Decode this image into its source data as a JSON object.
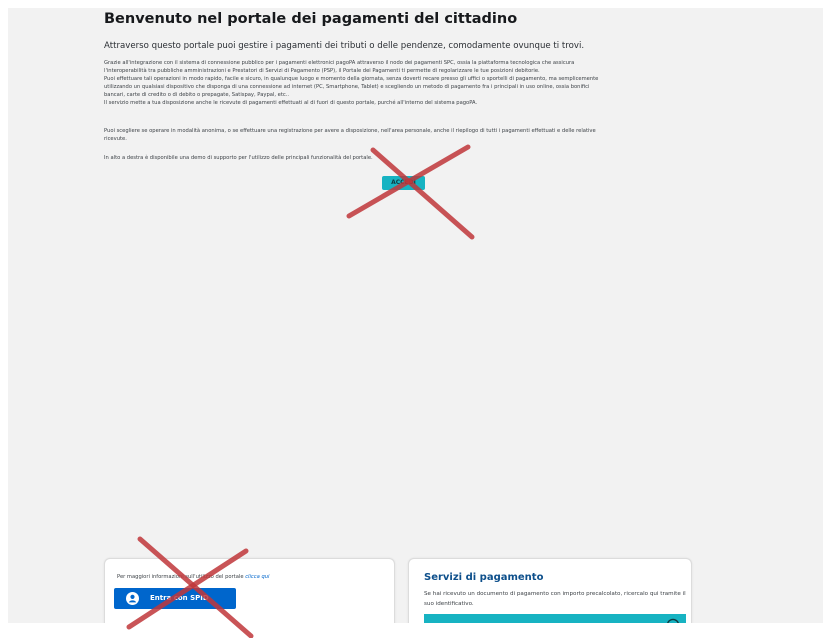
{
  "header": {
    "title": "Benvenuto nel portale dei pagamenti del cittadino",
    "subtitle": "Attraverso questo portale puoi gestire i pagamenti dei tributi o delle pendenze, comodamente ovunque ti trovi."
  },
  "intro": {
    "lines": [
      "Grazie all'integrazione con il sistema di connessione pubblico per i pagamenti elettronici pagoPA attraverso il nodo dei pagamenti SPC, ossia la piattaforma tecnologica che assicura",
      "l'interoperabilità tra pubbliche amministrazioni e Prestatori di Servizi di Pagamento (PSP), il Portale dei Pagamenti ti permette di regolarizzare le tue posizioni debitorie.",
      "Puoi effettuare tali operazioni in modo rapido, facile e sicuro, in qualunque luogo e momento della giornata, senza doverti recare presso gli uffici o sportelli di pagamento, ma semplicemente",
      "utilizzando un qualsiasi dispositivo che disponga di una connessione ad internet (PC, Smartphone, Tablet) e scegliendo un metodo di pagamento fra i principali in uso online, ossia bonifici",
      "bancari, carte di credito o di debito o prepagate, Satispay, Paypal, etc..",
      "Il servizio mette a tua disposizione anche le ricevute di pagamenti effettuati al di fuori di questo portale, purché all'interno del sistema pagoPA."
    ],
    "choose_lines": [
      "Puoi scegliere se operare in modalità anonima, o se effettuare una registrazione per avere a disposizione, nell'area personale, anche il riepilogo di tutti i pagamenti effettuati e delle relative",
      "ricevute."
    ],
    "demo_text": "In alto a destra è disponibile una demo di supporto per l'utilizzo delle principali funzionalità del portale."
  },
  "access_button": {
    "label": "ACCEDI"
  },
  "login_card": {
    "info_text": "Per maggiori informazioni sull'utilizzo del portale",
    "info_link": "clicca qui",
    "spid_label": "Entra con SPID"
  },
  "services_card": {
    "title": "Servizi di pagamento",
    "description": "Se hai ricevuto un documento di pagamento con importo precalcolato, ricercalo qui tramite il suo identificativo."
  },
  "colors": {
    "accent_teal": "#17b3c2",
    "primary_blue": "#0066cc",
    "title_blue": "#0d4f8b",
    "annotation_red": "#c0363a"
  },
  "icons": [
    "user-circle-icon",
    "circle-icon",
    "red-cross-mark"
  ]
}
